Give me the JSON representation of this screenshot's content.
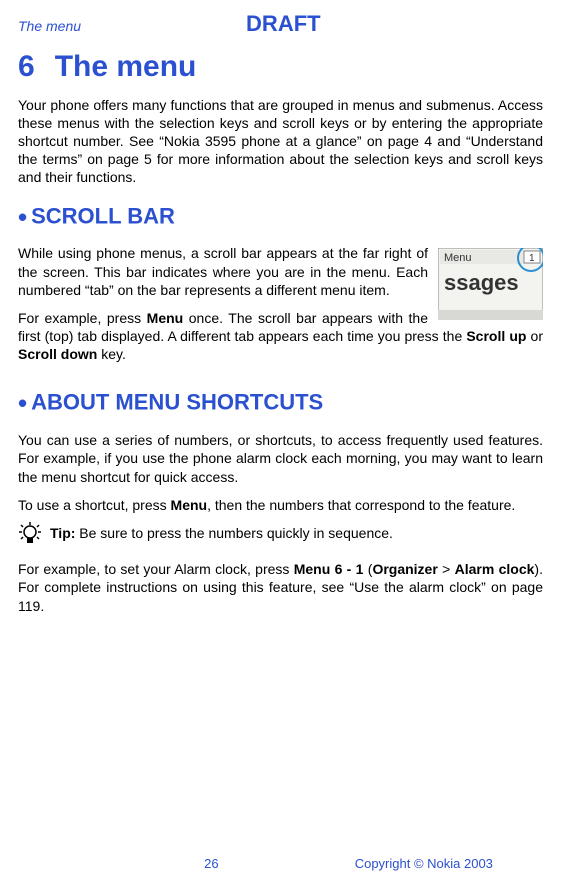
{
  "header": {
    "section_label": "The menu",
    "draft_label": "DRAFT"
  },
  "chapter": {
    "number": "6",
    "title": "The menu"
  },
  "intro": "Your phone offers many functions that are grouped in menus and submenus. Access these menus with the selection keys and scroll keys or by entering the appropriate shortcut number. See “Nokia 3595 phone at a glance” on page 4 and “Understand the terms” on page 5 for more information about the selection keys and scroll keys and their functions.",
  "scroll_bar": {
    "heading": "SCROLL BAR",
    "p1": "While using phone menus, a scroll bar appears at the far right of the screen. This bar indicates where you are in the menu. Each numbered “tab” on the bar represents a different menu item.",
    "p2_a": "For example, press ",
    "p2_menu": "Menu",
    "p2_b": " once. The scroll bar appears with the first (top) tab displayed. A different tab appears each time you press the ",
    "p2_scrollup": "Scroll up",
    "p2_or": " or ",
    "p2_scrolldown": "Scroll down",
    "p2_c": " key.",
    "phone_menu_label": "Menu",
    "phone_tab_num": "1",
    "phone_text": "ssages"
  },
  "shortcuts": {
    "heading": "ABOUT MENU SHORTCUTS",
    "p1": "You can use a series of numbers, or shortcuts, to access frequently used features. For example, if you use the phone alarm clock each morning, you may want to learn the menu shortcut for quick access.",
    "p2_a": "To use a shortcut, press ",
    "p2_menu": "Menu",
    "p2_b": ", then the numbers that correspond to the feature.",
    "tip_label": "Tip:",
    "tip_text": " Be sure to press the numbers quickly in sequence.",
    "p3_a": "For example, to set your Alarm clock, press ",
    "p3_menu": "Menu 6 - 1",
    "p3_paren_open": " (",
    "p3_organizer": "Organizer",
    "p3_gt": " > ",
    "p3_alarm": "Alarm clock",
    "p3_paren_close": ").",
    "p3_b": " For complete instructions on using this feature, see “Use the alarm clock” on page 119."
  },
  "footer": {
    "page": "26",
    "copyright": "Copyright © Nokia 2003"
  }
}
